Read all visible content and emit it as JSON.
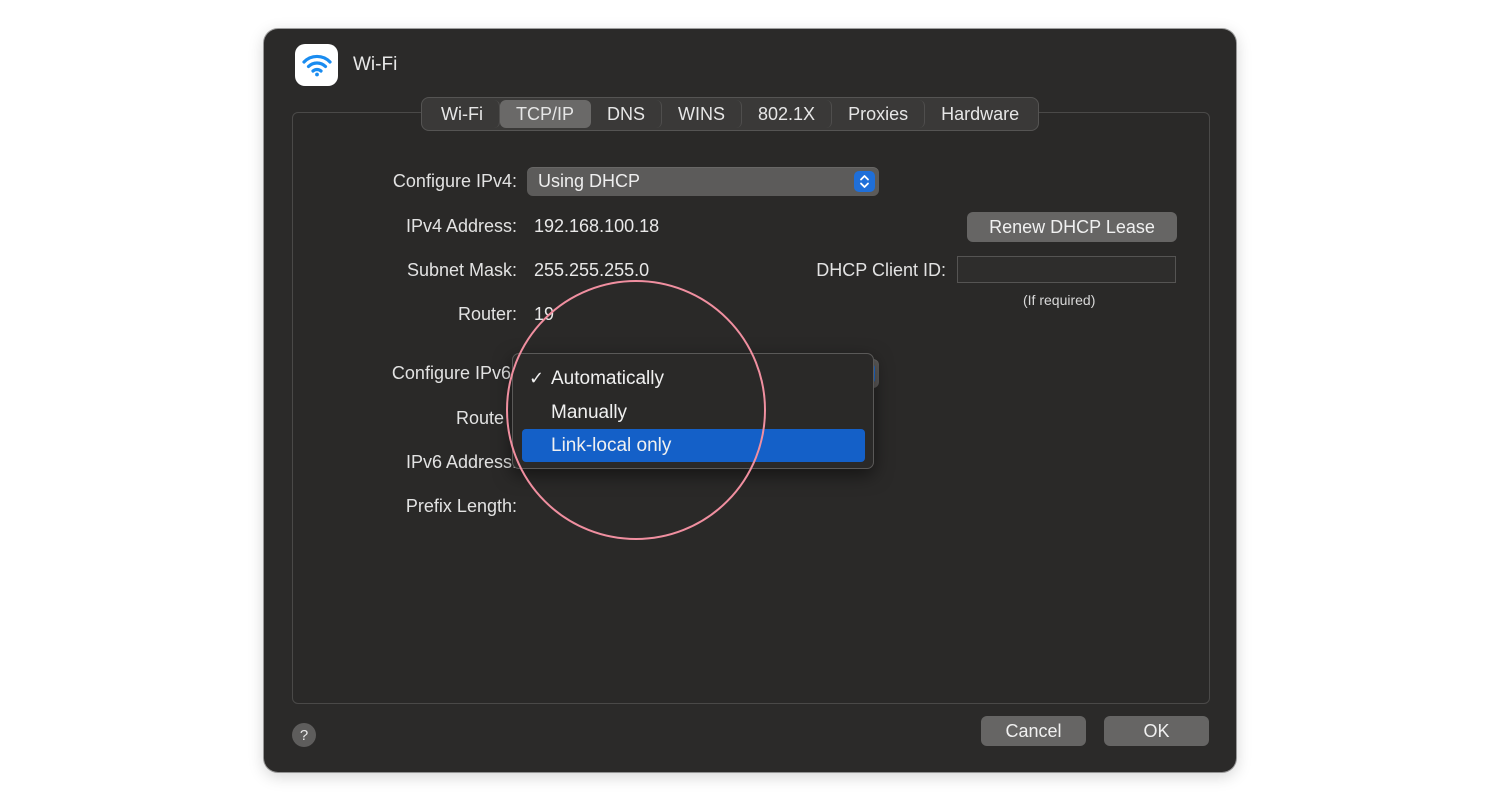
{
  "window": {
    "title": "Wi-Fi",
    "icon": "wifi-icon"
  },
  "tabs": [
    {
      "label": "Wi-Fi",
      "active": false
    },
    {
      "label": "TCP/IP",
      "active": true
    },
    {
      "label": "DNS",
      "active": false
    },
    {
      "label": "WINS",
      "active": false
    },
    {
      "label": "802.1X",
      "active": false
    },
    {
      "label": "Proxies",
      "active": false
    },
    {
      "label": "Hardware",
      "active": false
    }
  ],
  "ipv4": {
    "configure_label": "Configure IPv4:",
    "configure_value": "Using DHCP",
    "address_label": "IPv4 Address:",
    "address_value": "192.168.100.18",
    "subnet_label": "Subnet Mask:",
    "subnet_value": "255.255.255.0",
    "router_label": "Router:",
    "router_value_partial": "19"
  },
  "dhcp": {
    "renew_label": "Renew DHCP Lease",
    "client_id_label": "DHCP Client ID:",
    "client_id_value": "",
    "client_id_hint": "(If required)"
  },
  "ipv6": {
    "configure_label": "Configure IPv6",
    "router_label": "Route",
    "address_label": "IPv6 Address:",
    "prefix_label": "Prefix Length:"
  },
  "ipv6_menu": {
    "items": [
      {
        "label": "Automatically",
        "checked": true,
        "highlighted": false
      },
      {
        "label": "Manually",
        "checked": false,
        "highlighted": false
      },
      {
        "label": "Link-local only",
        "checked": false,
        "highlighted": true
      }
    ],
    "check_glyph": "✓"
  },
  "footer": {
    "help": "?",
    "cancel_label": "Cancel",
    "ok_label": "OK"
  },
  "colors": {
    "accent": "#1f6fd9",
    "menu_highlight": "#1460c8",
    "annotation_circle": "#f08fa0"
  }
}
